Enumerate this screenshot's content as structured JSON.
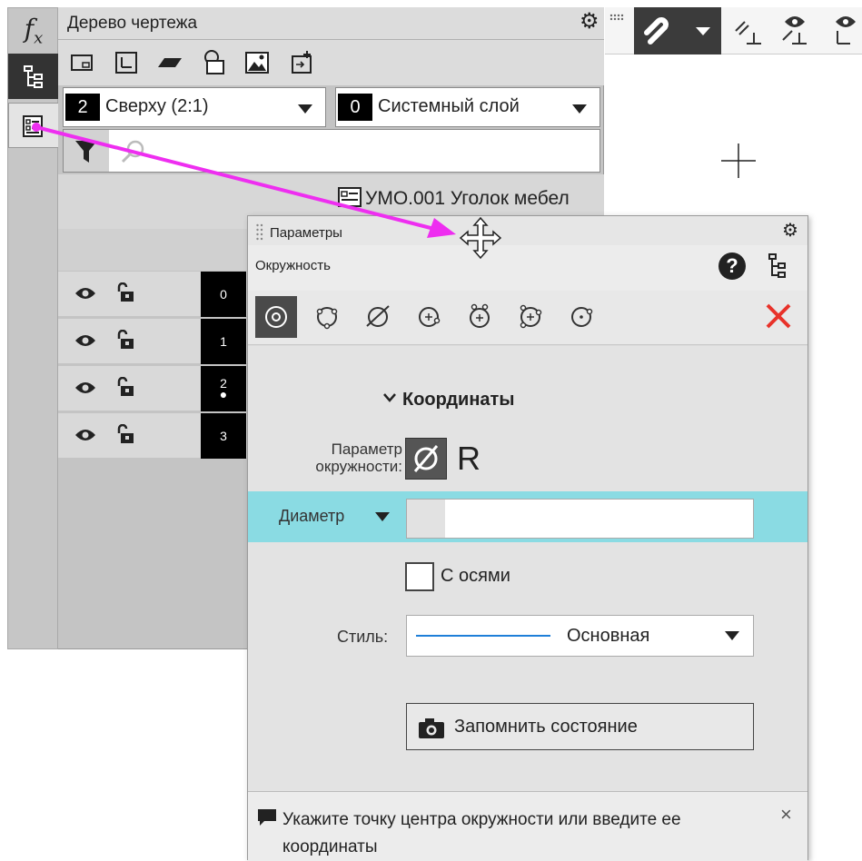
{
  "left_toolbar": {
    "fx_label": "f",
    "fx_sub": "x",
    "tools": [
      "formula-icon",
      "tree-icon",
      "parameters-icon"
    ]
  },
  "tree_panel": {
    "title": "Дерево чертежа",
    "toolbar_icons": [
      "rectangle-view-icon",
      "local-cs-view-icon",
      "parallelogram-icon",
      "shapes-icon",
      "image-icon",
      "link-icon"
    ],
    "view_select": {
      "number": "2",
      "label": "Сверху (2:1)"
    },
    "layer_select": {
      "number": "0",
      "label": "Системный слой"
    },
    "node_label": "УМО.001 Уголок мебел",
    "layers": [
      {
        "number": "0",
        "visible": true,
        "locked": false
      },
      {
        "number": "1",
        "visible": true,
        "locked": false
      },
      {
        "number": "2",
        "visible": true,
        "locked": false,
        "active": true
      },
      {
        "number": "3",
        "visible": true,
        "locked": false
      }
    ]
  },
  "params_panel": {
    "title": "Параметры",
    "subtitle": "Окружность",
    "help_label": "?",
    "tools": [
      "circle-center-radius-icon",
      "circle-3points-icon",
      "circle-tangent-icon",
      "circle-center-tangent-icon",
      "circle-2tangents-icon",
      "circle-3tangents-icon",
      "circle-2points-icon"
    ],
    "section_title": "Координаты",
    "circle_param_label_line1": "Параметр",
    "circle_param_label_line2": "окружности:",
    "radius_label": "R",
    "diameter_label": "Диаметр",
    "diameter_value": "",
    "axes_checkbox_label": "С осями",
    "axes_checked": false,
    "style_label": "Стиль:",
    "style_value": "Основная",
    "style_color": "#1e7fd8",
    "save_button_label": "Запомнить состояние",
    "hint": "Укажите точку центра окружности или введите ее координаты",
    "hint_close": "×"
  },
  "colors": {
    "annotation_arrow": "#ee2ef0",
    "close_red": "#e8322a",
    "highlight_row": "#8adbe3",
    "accent_blue": "#1e7fd8"
  }
}
